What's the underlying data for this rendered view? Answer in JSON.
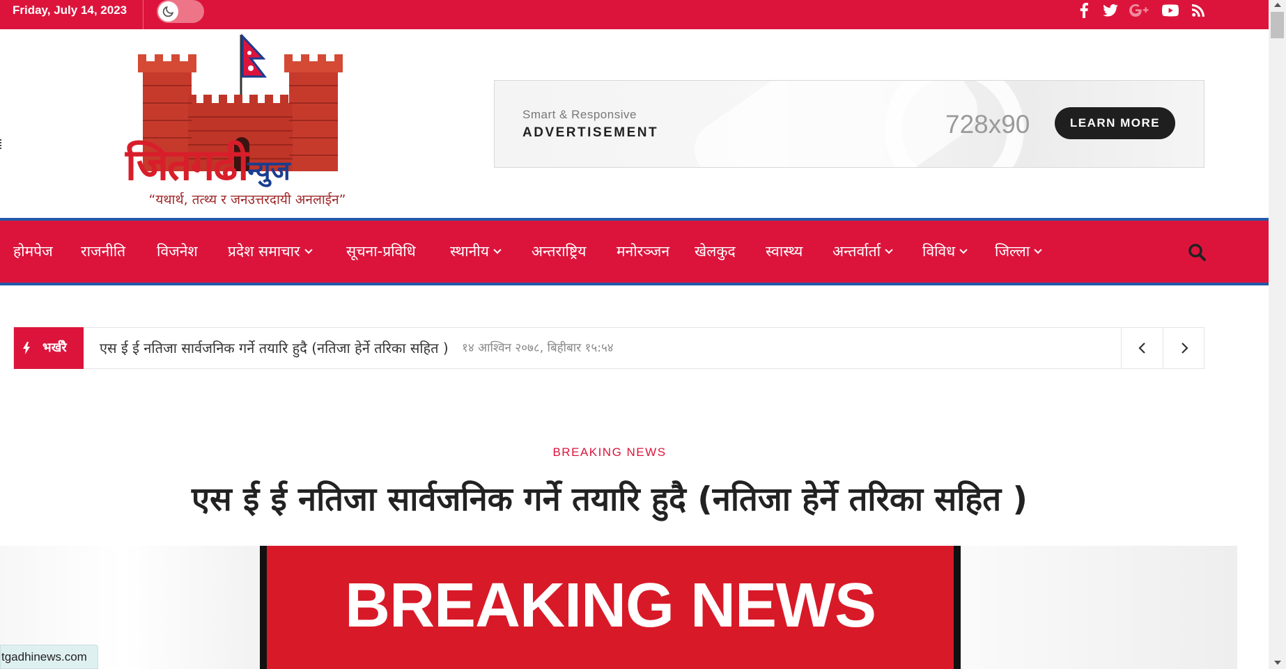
{
  "topbar": {
    "date": "Friday, July 14, 2023",
    "social_icons": [
      "facebook-icon",
      "twitter-icon",
      "google-plus-icon",
      "youtube-icon",
      "rss-icon"
    ]
  },
  "logo": {
    "name": "जितगढी",
    "suffix": "न्युज",
    "tagline": "“यथार्थ, तत्थ्य र जनउत्तरदायी अनलाईन”"
  },
  "ad": {
    "small_text": "Smart & Responsive",
    "big_text": "ADVERTISEMENT",
    "size_text": "728x90",
    "button_label": "LEARN MORE"
  },
  "nav": {
    "items": [
      {
        "label": "होमपेज",
        "has_dropdown": false
      },
      {
        "label": "राजनीति",
        "has_dropdown": false
      },
      {
        "label": "विजनेश",
        "has_dropdown": false
      },
      {
        "label": "प्रदेश समाचार",
        "has_dropdown": true
      },
      {
        "label": "सूचना-प्रविधि",
        "has_dropdown": false
      },
      {
        "label": "स्थानीय",
        "has_dropdown": true
      },
      {
        "label": "अन्तराष्ट्रिय",
        "has_dropdown": false
      },
      {
        "label": "मनोरञ्जन",
        "has_dropdown": false
      },
      {
        "label": "खेलकुद",
        "has_dropdown": false
      },
      {
        "label": "स्वास्थ्य",
        "has_dropdown": false
      },
      {
        "label": "अन्तर्वार्ता",
        "has_dropdown": true
      },
      {
        "label": "विविध",
        "has_dropdown": true
      },
      {
        "label": "जिल्ला",
        "has_dropdown": true
      }
    ]
  },
  "ticker": {
    "label": "भर्खरै",
    "headline": "एस ई ई नतिजा सार्वजनिक गर्ने तयारि हुदै (नतिजा हेर्ने तरिका सहित )",
    "time": "१४ आश्विन २०७८, बिहीबार १५:५४"
  },
  "article": {
    "category": "BREAKING NEWS",
    "title": "एस ई ई नतिजा सार्वजनिक गर्ने तयारि हुदै (नतिजा हेर्ने तरिका सहित )",
    "image_text": "BREAKING NEWS"
  },
  "status_url": "tgadhinews.com",
  "colors": {
    "brand_red": "#dc143c",
    "nav_border_blue": "#2458a8"
  }
}
